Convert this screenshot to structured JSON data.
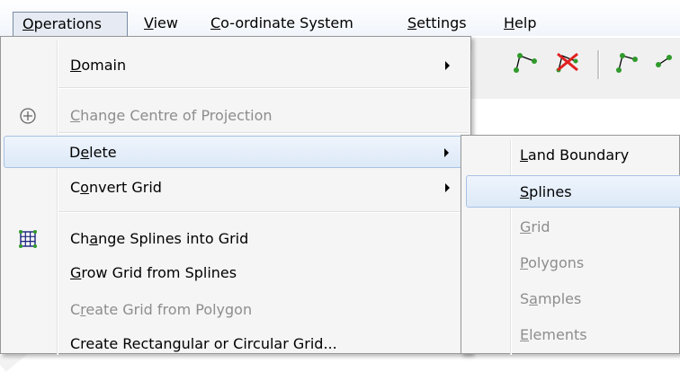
{
  "menubar": {
    "items": [
      {
        "label": "Operations",
        "mnemonic": "O",
        "rest": "perations"
      },
      {
        "label": "View",
        "mnemonic": "V",
        "rest": "iew"
      },
      {
        "label": "Co-ordinate System",
        "mnemonic": "C",
        "rest": "o-ordinate System"
      },
      {
        "label": "Settings",
        "mnemonic": "S",
        "rest": "ettings"
      },
      {
        "label": "Help",
        "mnemonic": "H",
        "rest": "elp"
      }
    ]
  },
  "menu": {
    "items": [
      {
        "pre": "",
        "mn": "D",
        "post": "omain"
      },
      {
        "pre": "",
        "mn": "C",
        "post": "hange Centre of Projection"
      },
      {
        "pre": "D",
        "mn": "e",
        "post": "lete"
      },
      {
        "pre": "C",
        "mn": "o",
        "post": "nvert Grid"
      },
      {
        "pre": "Ch",
        "mn": "a",
        "post": "nge Splines into Grid"
      },
      {
        "pre": "",
        "mn": "G",
        "post": "row Grid from Splines"
      },
      {
        "pre": "C",
        "mn": "r",
        "post": "eate Grid from Polygon"
      },
      {
        "pre": "Create Rectangular or Circular Grid...",
        "mn": "",
        "post": ""
      }
    ]
  },
  "submenu": {
    "items": [
      {
        "pre": "",
        "mn": "L",
        "post": "and Boundary"
      },
      {
        "pre": "",
        "mn": "S",
        "post": "plines"
      },
      {
        "pre": "",
        "mn": "G",
        "post": "rid"
      },
      {
        "pre": "",
        "mn": "P",
        "post": "olygons"
      },
      {
        "pre": "S",
        "mn": "a",
        "post": "mples"
      },
      {
        "pre": "",
        "mn": "E",
        "post": "lements"
      }
    ]
  },
  "icons": {
    "centre": "circle-plus-icon",
    "grid": "grid-icon",
    "spline_green": "#2f9a2a",
    "delete_red": "#e02020"
  }
}
